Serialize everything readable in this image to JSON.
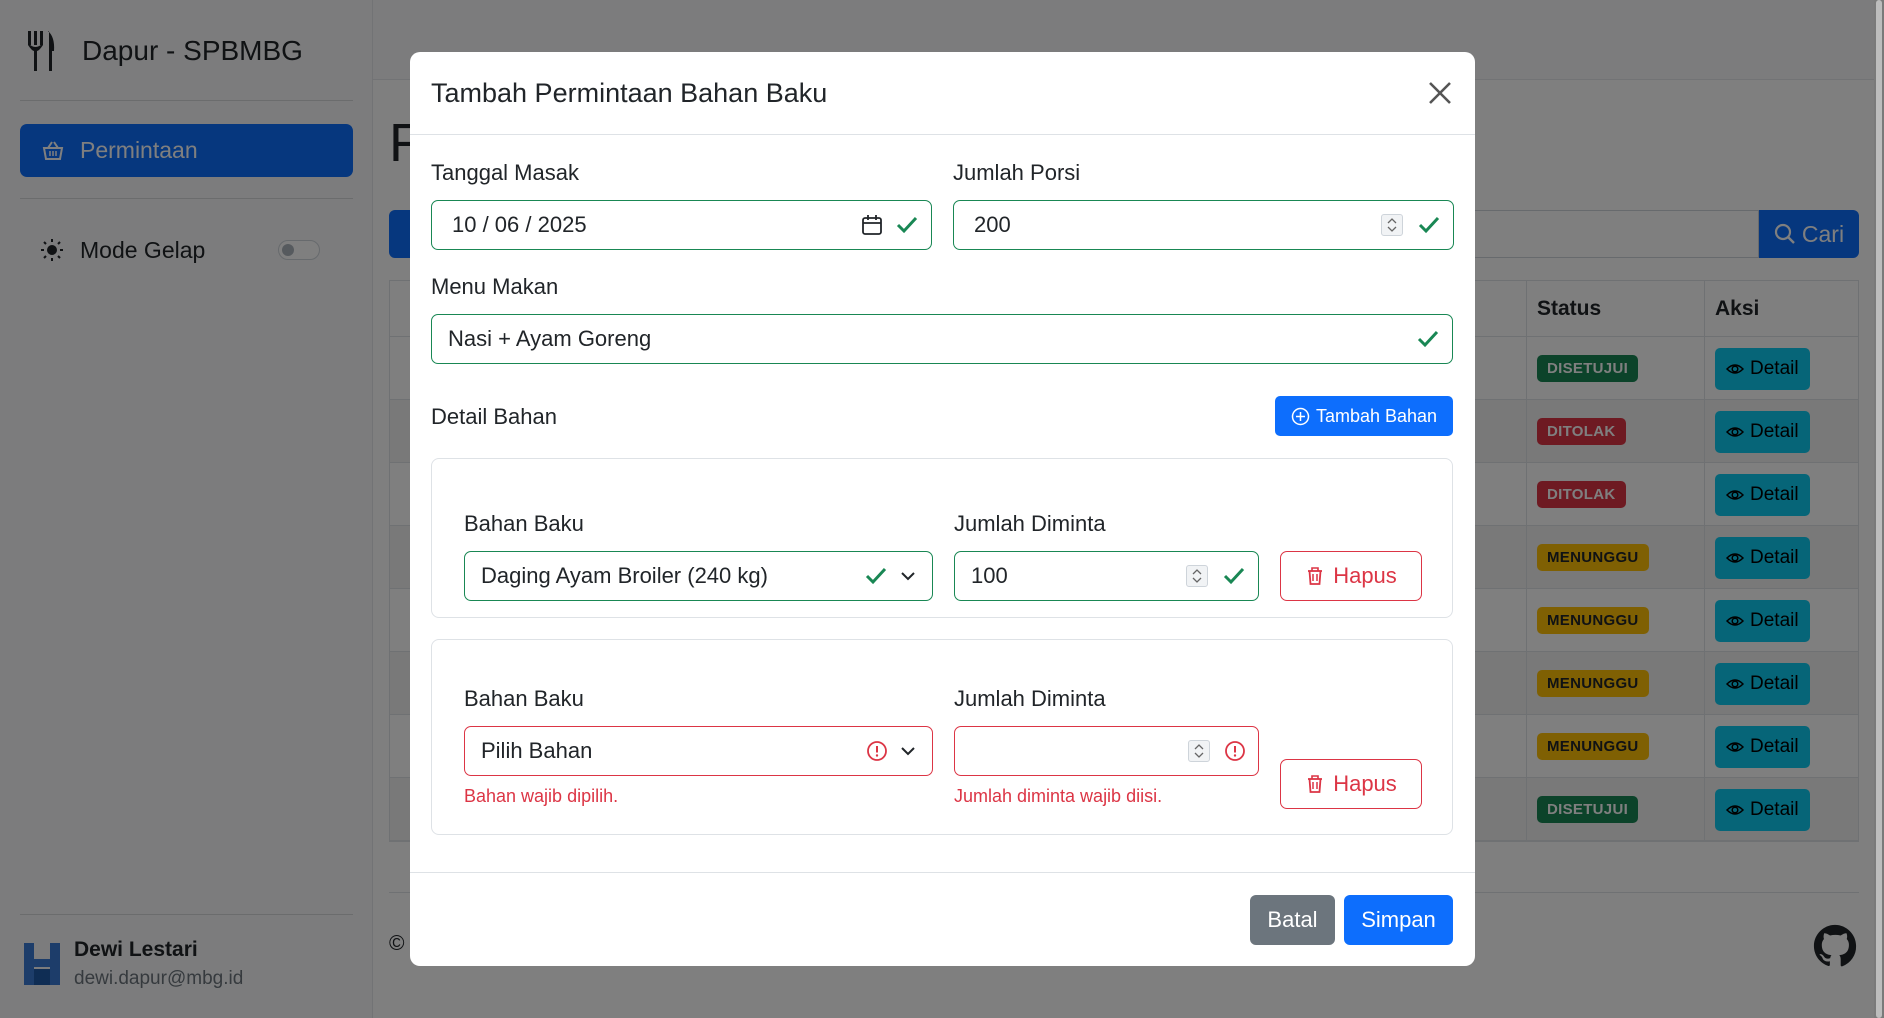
{
  "sidebar": {
    "brand_title": "Dapur - SPBMBG",
    "nav_active_label": "Permintaan",
    "mode_label": "Mode Gelap",
    "user_name": "Dewi Lestari",
    "user_email": "dewi.dapur@mbg.id"
  },
  "background": {
    "page_title_partial": "F",
    "search_button_label": "Cari",
    "copyright_partial": "©",
    "table_headers": {
      "status": "Status",
      "aksi": "Aksi"
    },
    "rows": [
      {
        "status": "DISETUJUI",
        "status_type": "ok",
        "action": "Detail"
      },
      {
        "status": "DITOLAK",
        "status_type": "no",
        "action": "Detail"
      },
      {
        "status": "DITOLAK",
        "status_type": "no",
        "action": "Detail"
      },
      {
        "status": "MENUNGGU",
        "status_type": "wait",
        "action": "Detail"
      },
      {
        "status": "MENUNGGU",
        "status_type": "wait",
        "action": "Detail"
      },
      {
        "status": "MENUNGGU",
        "status_type": "wait",
        "action": "Detail"
      },
      {
        "status": "MENUNGGU",
        "status_type": "wait",
        "action": "Detail"
      },
      {
        "status": "DISETUJUI",
        "status_type": "ok",
        "action": "Detail"
      }
    ]
  },
  "modal": {
    "title": "Tambah Permintaan Bahan Baku",
    "tanggal_label": "Tanggal Masak",
    "tanggal_value": "10 / 06 / 2025",
    "porsi_label": "Jumlah Porsi",
    "porsi_value": "200",
    "menu_label": "Menu Makan",
    "menu_value": "Nasi + Ayam Goreng",
    "detail_label": "Detail Bahan",
    "tambah_label": "Tambah Bahan",
    "items": [
      {
        "bahan_label": "Bahan Baku",
        "bahan_value": "Daging Ayam Broiler (240 kg)",
        "jumlah_label": "Jumlah Diminta",
        "jumlah_value": "100",
        "hapus_label": "Hapus"
      },
      {
        "bahan_label": "Bahan Baku",
        "bahan_value": "Pilih Bahan",
        "bahan_error": "Bahan wajib dipilih.",
        "jumlah_label": "Jumlah Diminta",
        "jumlah_value": "",
        "jumlah_error": "Jumlah diminta wajib diisi.",
        "hapus_label": "Hapus"
      }
    ],
    "batal_label": "Batal",
    "simpan_label": "Simpan"
  },
  "colors": {
    "primary": "#0d6efd",
    "success": "#198754",
    "danger": "#dc3545",
    "warning": "#ffc107",
    "info": "#0dcaf0",
    "secondary": "#6c757d"
  }
}
